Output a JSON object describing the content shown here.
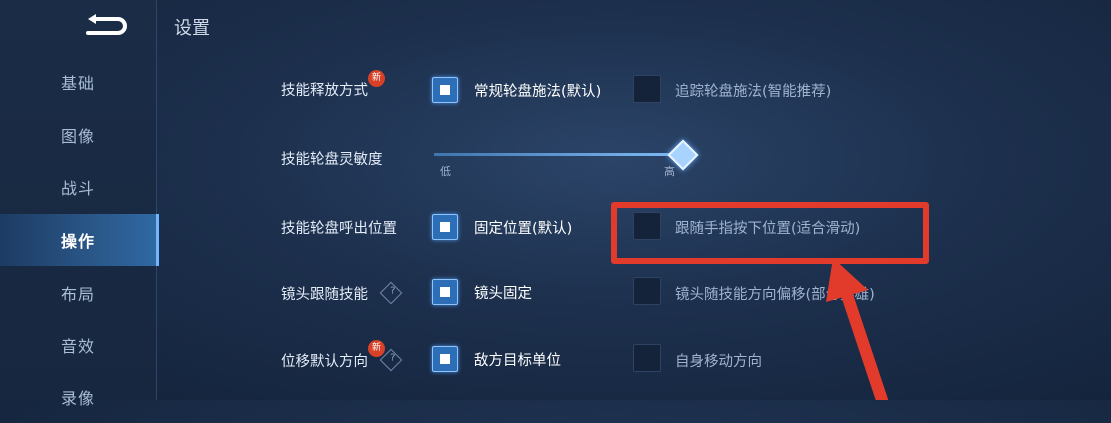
{
  "sidebar": {
    "items": [
      {
        "label": "基础",
        "active": false
      },
      {
        "label": "图像",
        "active": false
      },
      {
        "label": "战斗",
        "active": false
      },
      {
        "label": "操作",
        "active": true
      },
      {
        "label": "布局",
        "active": false
      },
      {
        "label": "音效",
        "active": false
      },
      {
        "label": "录像",
        "active": false
      }
    ]
  },
  "page": {
    "title": "设置"
  },
  "settings": {
    "skill_release": {
      "label": "技能释放方式",
      "badge": "新",
      "options": [
        {
          "label": "常规轮盘施法(默认)",
          "selected": true
        },
        {
          "label": "追踪轮盘施法(智能推荐)",
          "selected": false
        }
      ]
    },
    "wheel_sensitivity": {
      "label": "技能轮盘灵敏度",
      "low": "低",
      "high": "高",
      "value": 1.0
    },
    "wheel_position": {
      "label": "技能轮盘呼出位置",
      "options": [
        {
          "label": "固定位置(默认)",
          "selected": true
        },
        {
          "label": "跟随手指按下位置(适合滑动)",
          "selected": false
        }
      ]
    },
    "camera_follow": {
      "label": "镜头跟随技能",
      "help": "?",
      "options": [
        {
          "label": "镜头固定",
          "selected": true
        },
        {
          "label": "镜头随技能方向偏移(部分英雄)",
          "selected": false
        }
      ]
    },
    "move_direction": {
      "label": "位移默认方向",
      "badge": "新",
      "help": "?",
      "options": [
        {
          "label": "敌方目标单位",
          "selected": true
        },
        {
          "label": "自身移动方向",
          "selected": false
        }
      ]
    }
  },
  "colors": {
    "annotation_red": "#e23b2b",
    "accent_blue": "#2d6fb7"
  }
}
